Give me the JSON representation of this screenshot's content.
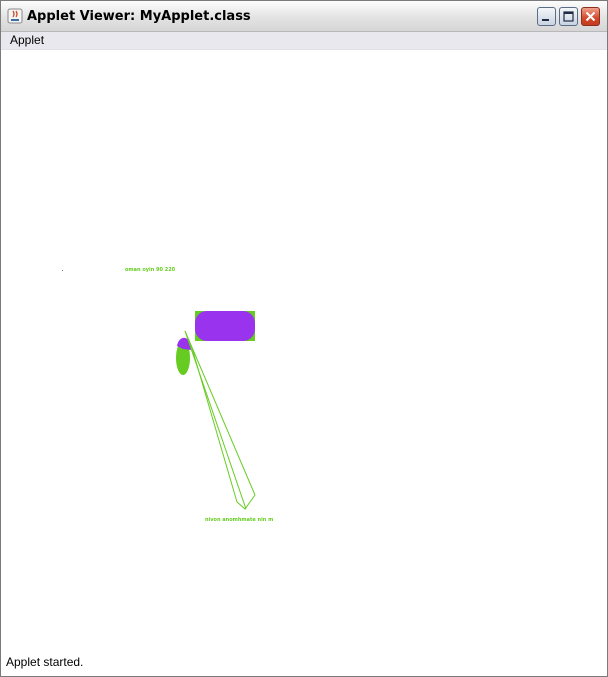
{
  "window": {
    "title": "Applet Viewer: MyApplet.class",
    "icon": "java-icon"
  },
  "titlebar_buttons": {
    "minimize": "minimize-icon",
    "maximize": "maximize-icon",
    "close": "close-icon"
  },
  "menu": {
    "items": [
      {
        "label": "Applet"
      }
    ]
  },
  "canvas": {
    "texts": {
      "upper": "oman oyin 90 220",
      "lower": "nivon anomhmate nin m"
    },
    "colors": {
      "green": "#66cc22",
      "purple": "#9933ee"
    }
  },
  "status": {
    "text": "Applet started."
  }
}
